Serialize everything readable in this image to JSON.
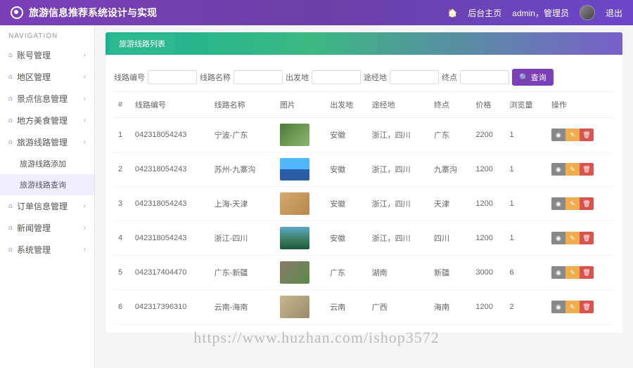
{
  "header": {
    "title": "旅游信息推荐系统设计与实现",
    "home_link": "后台主页",
    "user_text": "admin，管理员",
    "logout": "退出"
  },
  "sidebar": {
    "heading": "NAVIGATION",
    "items": [
      {
        "label": "账号管理",
        "has_children": true
      },
      {
        "label": "地区管理",
        "has_children": true
      },
      {
        "label": "景点信息管理",
        "has_children": true
      },
      {
        "label": "地方美食管理",
        "has_children": true
      },
      {
        "label": "旅游线路管理",
        "has_children": true
      },
      {
        "label": "旅游线路添加",
        "sub": true
      },
      {
        "label": "旅游线路查询",
        "sub": true,
        "active": true
      },
      {
        "label": "订单信息管理",
        "has_children": true
      },
      {
        "label": "新闻管理",
        "has_children": true
      },
      {
        "label": "系统管理",
        "has_children": true
      }
    ]
  },
  "panel": {
    "tab_title": "旅游线路列表"
  },
  "search": {
    "fields": [
      {
        "label": "线路编号"
      },
      {
        "label": "线路名称"
      },
      {
        "label": "出发地"
      },
      {
        "label": "途经地"
      },
      {
        "label": "终点"
      }
    ],
    "button": "查询"
  },
  "table": {
    "columns": [
      "#",
      "线路编号",
      "线路名称",
      "图片",
      "出发地",
      "途经地",
      "终点",
      "价格",
      "浏览量",
      "操作"
    ],
    "rows": [
      {
        "idx": "1",
        "code": "042318054243",
        "name": "宁波-广东",
        "thumb": "thumb-1",
        "from": "安徽",
        "via": "浙江，四川",
        "to": "广东",
        "price": "2200",
        "views": "1"
      },
      {
        "idx": "2",
        "code": "042318054243",
        "name": "苏州-九寨沟",
        "thumb": "thumb-2",
        "from": "安徽",
        "via": "浙江，四川",
        "to": "九寨沟",
        "price": "1200",
        "views": "1"
      },
      {
        "idx": "3",
        "code": "042318054243",
        "name": "上海-天津",
        "thumb": "thumb-3",
        "from": "安徽",
        "via": "浙江，四川",
        "to": "天津",
        "price": "1200",
        "views": "1"
      },
      {
        "idx": "4",
        "code": "042318054243",
        "name": "浙江-四川",
        "thumb": "thumb-4",
        "from": "安徽",
        "via": "浙江，四川",
        "to": "四川",
        "price": "1200",
        "views": "1"
      },
      {
        "idx": "5",
        "code": "042317404470",
        "name": "广东-新疆",
        "thumb": "thumb-5",
        "from": "广东",
        "via": "湖南",
        "to": "新疆",
        "price": "3000",
        "views": "6"
      },
      {
        "idx": "6",
        "code": "042317396310",
        "name": "云南-海南",
        "thumb": "thumb-6",
        "from": "云南",
        "via": "广西",
        "to": "海南",
        "price": "1200",
        "views": "2"
      }
    ]
  },
  "watermark": "https://www.huzhan.com/ishop3572"
}
